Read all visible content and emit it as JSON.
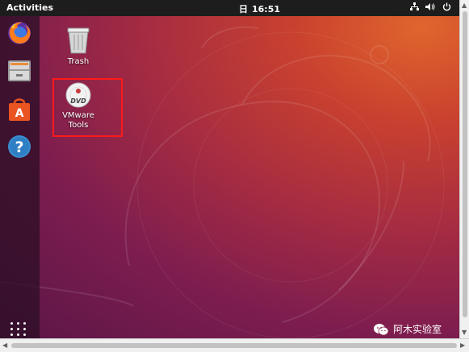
{
  "topbar": {
    "activities": "Activities",
    "clock_day": "日",
    "clock_time": "16:51",
    "tray_icons": [
      "network-icon",
      "volume-icon",
      "power-icon"
    ]
  },
  "dock": {
    "items": [
      "firefox-icon",
      "files-icon",
      "software-icon",
      "help-icon"
    ],
    "show_apps": "show-applications-icon"
  },
  "desktop": {
    "icons": [
      {
        "name": "Trash",
        "label": "Trash"
      },
      {
        "name": "VMware Tools",
        "label_line1": "VMware",
        "label_line2": "Tools"
      }
    ]
  },
  "watermark": {
    "text": "阿木实验室"
  },
  "colors": {
    "topbar": "#1d1d1d",
    "highlight": "#ff1a1a",
    "accent": "#e95420"
  }
}
